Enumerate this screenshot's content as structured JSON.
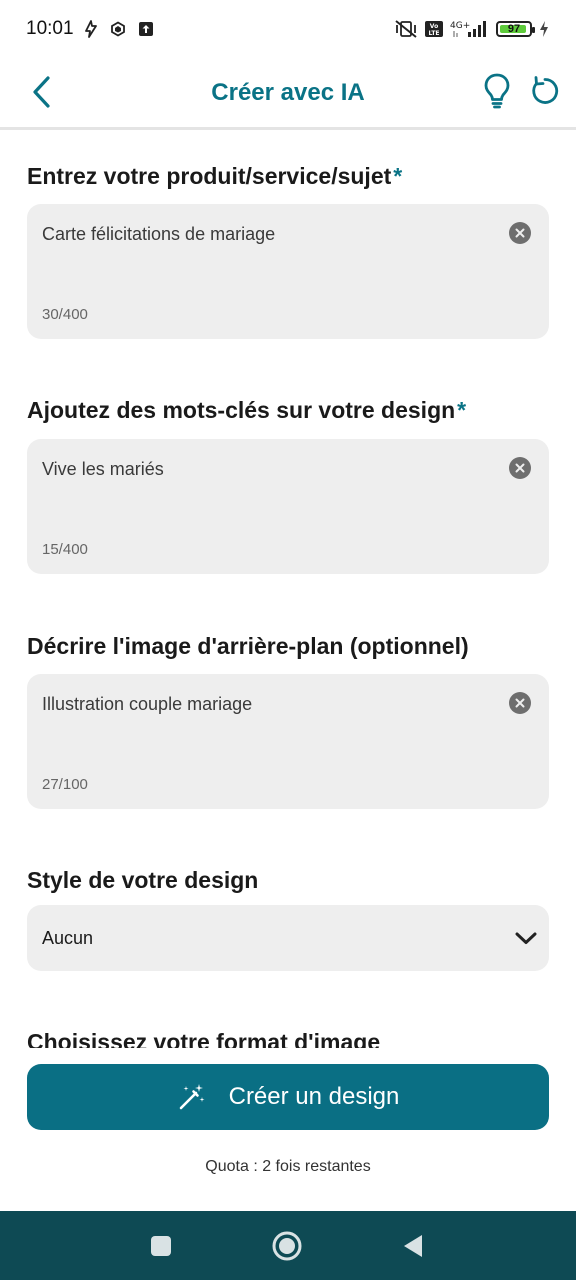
{
  "status_bar": {
    "time": "10:01",
    "left_icons": [
      "signal-arrow-icon",
      "hexagon-app-icon",
      "upload-icon"
    ],
    "right_icons": [
      "vibrate-off-icon",
      "volte-icon",
      "network-4g-icon",
      "signal-bars-icon",
      "battery-icon",
      "charging-icon"
    ],
    "volte_label": "Vo LTE",
    "network_label": "4G+",
    "battery_level": "97",
    "battery_color": "#5ecb3b"
  },
  "header": {
    "title": "Créer avec IA",
    "accent_color": "#0a7386"
  },
  "form": {
    "product": {
      "label": "Entrez votre produit/service/sujet",
      "required_mark": "*",
      "value": "Carte félicitations de mariage",
      "counter": "30/400"
    },
    "keywords": {
      "label": "Ajoutez des mots-clés sur votre design",
      "required_mark": "*",
      "value": "Vive les mariés",
      "counter": "15/400"
    },
    "background": {
      "label": "Décrire l'image d'arrière-plan (optionnel)",
      "value": "Illustration couple mariage",
      "counter": "27/100"
    },
    "style": {
      "label": "Style de votre design",
      "selected": "Aucun"
    },
    "format": {
      "label": "Choisissez votre format d'image"
    }
  },
  "action": {
    "create_label": "Créer un design",
    "button_color": "#0a6f84"
  },
  "quota": {
    "text": "Quota : 2 fois restantes"
  },
  "navbar": {
    "background_color": "#0e4a54"
  }
}
